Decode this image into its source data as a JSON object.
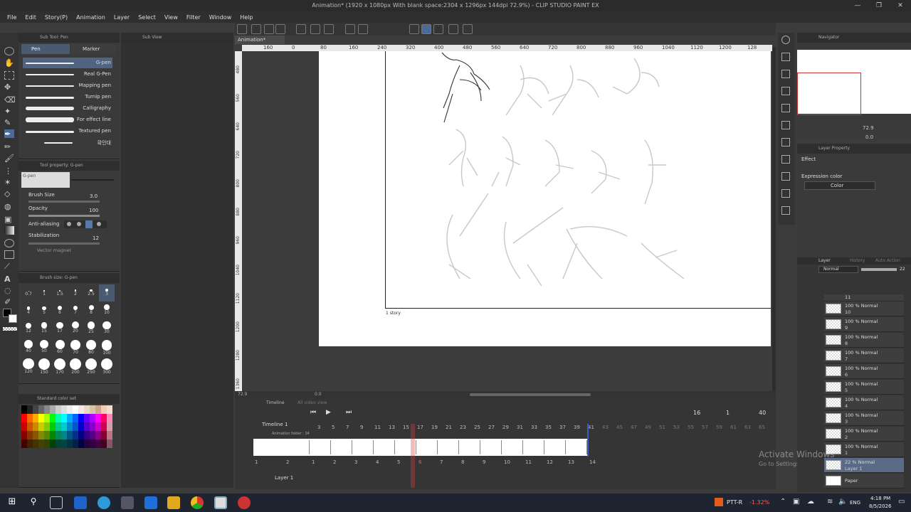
{
  "window": {
    "title": "Animation* (1920 x 1080px With blank space:2304 x 1296px 144dpi 72.9%) - CLIP STUDIO PAINT EX",
    "min": "—",
    "max": "❐",
    "close": "✕"
  },
  "menu": [
    "File",
    "Edit",
    "Story(P)",
    "Animation",
    "Layer",
    "Select",
    "View",
    "Filter",
    "Window",
    "Help"
  ],
  "subtool": {
    "title": "Sub Tool: Pen",
    "tabs": [
      "Pen",
      "Marker"
    ],
    "brushes": [
      "G-pen",
      "Real G-Pen",
      "Mapping pen",
      "Turnip pen",
      "Calligraphy",
      "For effect line",
      "Textured pen",
      "확인대"
    ]
  },
  "subview_title": "Sub View",
  "toolprop": {
    "title": "Tool property: G-pen",
    "preview_label": "G-pen",
    "brush_size_label": "Brush Size",
    "brush_size": "3.0",
    "opacity_label": "Opacity",
    "opacity": "100",
    "antialias_label": "Anti-aliasing",
    "stabilization_label": "Stabilization",
    "stabilization": "12",
    "vector_magnet_label": "Vector magnet"
  },
  "brushsize": {
    "title": "Brush size: G-pen",
    "sizes": [
      "0.7",
      "1",
      "1.5",
      "2",
      "2.5",
      "3",
      "4",
      "5",
      "6",
      "7",
      "8",
      "10",
      "12",
      "15",
      "17",
      "20",
      "25",
      "30",
      "40",
      "50",
      "60",
      "70",
      "80",
      "100",
      "120",
      "150",
      "170",
      "200",
      "250",
      "300"
    ]
  },
  "colorset": {
    "title": "Standard color set"
  },
  "canvas": {
    "tab": "Animation*",
    "ruler_h": [
      "160",
      "0",
      "80",
      "160",
      "240",
      "320",
      "400",
      "480",
      "560",
      "640",
      "720",
      "800",
      "880",
      "960",
      "1040",
      "1120",
      "1200",
      "128"
    ],
    "ruler_v": [
      "480",
      "560",
      "640",
      "720",
      "800",
      "880",
      "960",
      "1040",
      "1120",
      "1200",
      "1280",
      "1360"
    ],
    "frame_label": "1 story",
    "zoom": "72.9",
    "angle": "0.0"
  },
  "timeline": {
    "title": "Timeline",
    "tab2": "All video view",
    "name": "Timeline 1",
    "current_frame": "16",
    "start": "1",
    "end": "40",
    "header_frames": [
      "3",
      "5",
      "7",
      "9",
      "11",
      "13",
      "15",
      "17",
      "19",
      "21",
      "23",
      "25",
      "27",
      "29",
      "31",
      "33",
      "35",
      "37",
      "39",
      "41",
      "43",
      "45",
      "47",
      "49",
      "51",
      "53",
      "55",
      "57",
      "59",
      "61",
      "63",
      "65"
    ],
    "cell_frames": [
      "1",
      "2",
      "1",
      "2",
      "3",
      "4",
      "5",
      "6",
      "7",
      "8",
      "9",
      "10",
      "11",
      "12",
      "13",
      "14"
    ],
    "track_folder": "Animation folder : 34",
    "track_layer": "Layer 1"
  },
  "navigator": {
    "title": "Navigator",
    "zoom": "72.9",
    "angle": "0.0"
  },
  "layer_property": {
    "title": "Layer Property",
    "effect_label": "Effect",
    "expression_label": "Expression color",
    "expression_value": "Color"
  },
  "layers": {
    "title": "Layer",
    "tab_history": "History",
    "tab_auto": "Auto Action",
    "blend": "Normal",
    "opacity": "22",
    "items": [
      {
        "l1": "11",
        "l2": ""
      },
      {
        "l1": "100 % Normal",
        "l2": "10"
      },
      {
        "l1": "100 % Normal",
        "l2": "9"
      },
      {
        "l1": "100 % Normal",
        "l2": "8"
      },
      {
        "l1": "100 % Normal",
        "l2": "7"
      },
      {
        "l1": "100 % Normal",
        "l2": "6"
      },
      {
        "l1": "100 % Normal",
        "l2": "5"
      },
      {
        "l1": "100 % Normal",
        "l2": "4"
      },
      {
        "l1": "100 % Normal",
        "l2": "3"
      },
      {
        "l1": "100 % Normal",
        "l2": "2"
      },
      {
        "l1": "100 % Normal",
        "l2": "1"
      },
      {
        "l1": "22 % Normal",
        "l2": "Layer 1"
      },
      {
        "l1": "Paper",
        "l2": ""
      }
    ]
  },
  "watermark": {
    "line1": "Activate Windows",
    "line2": "Go to Settings to activate Windows."
  },
  "taskbar": {
    "stock_name": "PTT-R",
    "stock_change": "-1.32%",
    "lang": "ENG",
    "time": "4:18 PM",
    "date": "8/5/2026"
  }
}
